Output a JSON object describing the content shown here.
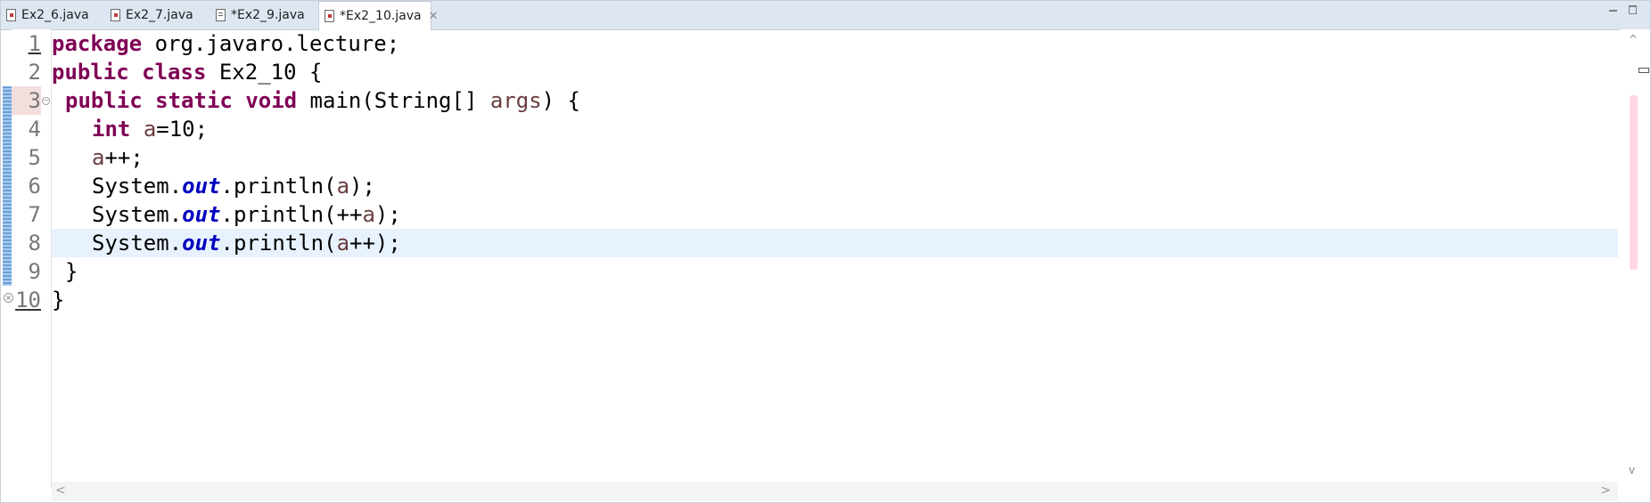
{
  "tabs": [
    {
      "label": "Ex2_6.java",
      "icon": "java-file-error-icon",
      "active": false
    },
    {
      "label": "Ex2_7.java",
      "icon": "java-file-error-icon",
      "active": false
    },
    {
      "label": "*Ex2_9.java",
      "icon": "java-file-icon",
      "active": false
    },
    {
      "label": "*Ex2_10.java",
      "icon": "java-file-error-icon",
      "active": true,
      "close": "✕"
    }
  ],
  "line_numbers": [
    "1",
    "2",
    "3",
    "4",
    "5",
    "6",
    "7",
    "8",
    "9",
    "10"
  ],
  "code": {
    "l1": {
      "kw": "package",
      "rest": " org.javaro.lecture;"
    },
    "l2": {
      "kw1": "public",
      "kw2": "class",
      "rest": " Ex2_10 {"
    },
    "l3": {
      "kw1": "public",
      "kw2": "static",
      "kw3": "void",
      "rest1": " main(String[] ",
      "var": "args",
      "rest2": ") {"
    },
    "l4": {
      "kw": "int",
      "var": "a",
      "rest": "=10;"
    },
    "l5": {
      "var": "a",
      "rest": "++;"
    },
    "l6": {
      "pre": "System.",
      "fld": "out",
      "mid": ".println(",
      "var": "a",
      "post": ");"
    },
    "l7": {
      "pre": "System.",
      "fld": "out",
      "mid": ".println(++",
      "var": "a",
      "post": ");"
    },
    "l8": {
      "pre": "System.",
      "fld": "out",
      "mid": ".println(",
      "var": "a",
      "post": "++);"
    },
    "l9": {
      "text": "}"
    },
    "l10": {
      "text": "}"
    }
  },
  "colors": {
    "keyword": "#7f0055",
    "static_field": "#0000c0",
    "local_variable": "#6a3e3e",
    "current_line": "#e8f2fe",
    "tabbar": "#dde6f1"
  },
  "scroll": {
    "left_arrow": "<",
    "right_arrow": ">",
    "up_arrow": "^",
    "down_arrow": "v"
  }
}
